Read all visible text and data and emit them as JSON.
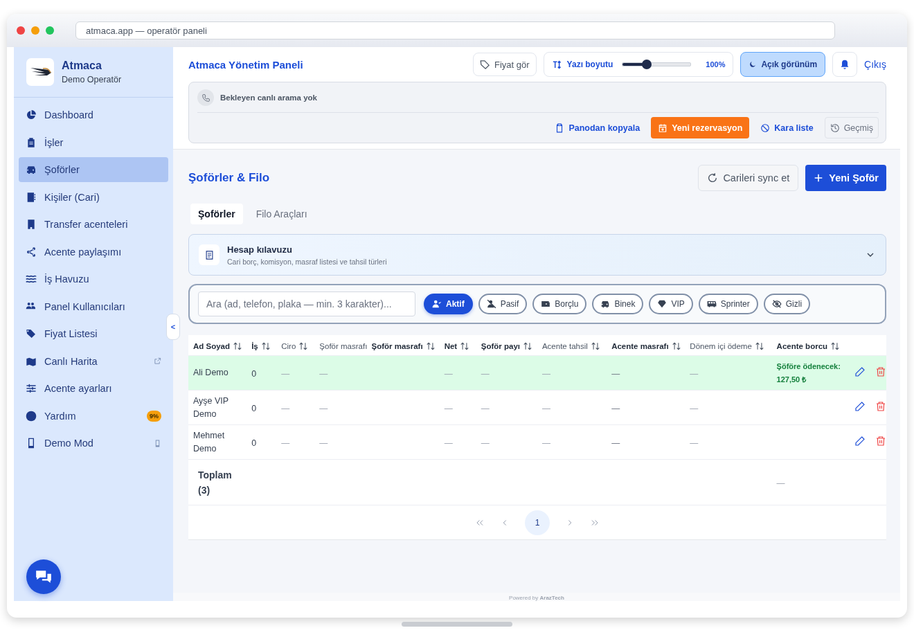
{
  "browser": {
    "address": "atmaca.app — operatör paneli"
  },
  "brand": {
    "name": "Atmaca",
    "subtitle": "Demo Operatör"
  },
  "sidebar": {
    "items": [
      {
        "label": "Dashboard",
        "selected": false,
        "kind": "plain"
      },
      {
        "label": "İşler",
        "selected": false,
        "kind": "plain"
      },
      {
        "label": "Şoförler",
        "selected": true,
        "kind": "plain"
      },
      {
        "label": "Kişiler (Cari)",
        "selected": false,
        "kind": "plain"
      },
      {
        "label": "Transfer acenteleri",
        "selected": false,
        "kind": "plain"
      },
      {
        "label": "Acente paylaşımı",
        "selected": false,
        "kind": "plain"
      },
      {
        "label": "İş Havuzu",
        "selected": false,
        "kind": "plain"
      },
      {
        "label": "Panel Kullanıcıları",
        "selected": false,
        "kind": "plain"
      },
      {
        "label": "Fiyat Listesi",
        "selected": false,
        "kind": "plain"
      },
      {
        "label": "Canlı Harita",
        "selected": false,
        "kind": "external"
      },
      {
        "label": "Acente ayarları",
        "selected": false,
        "kind": "plain"
      },
      {
        "label": "Yardım",
        "selected": false,
        "kind": "badge",
        "badge": "9%"
      },
      {
        "label": "Demo Mod",
        "selected": false,
        "kind": "device"
      }
    ],
    "collapse_button": "<"
  },
  "header": {
    "title": "Atmaca Yönetim Paneli",
    "price_button": "Fiyat gör",
    "font_size": {
      "label": "Yazı boyutu",
      "level": 0.35,
      "reading": "100%"
    },
    "theme_button": "Açık görünüm",
    "logout": "Çıkış"
  },
  "call_panel": {
    "status": "Bekleyen canlı arama yok",
    "actions": [
      {
        "label": "Panodan kopyala",
        "kind": "link"
      },
      {
        "label": "Yeni rezervasyon",
        "kind": "primary"
      },
      {
        "label": "Kara liste",
        "kind": "link"
      },
      {
        "label": "Geçmiş",
        "kind": "outline"
      }
    ]
  },
  "page": {
    "title": "Şoförler & Filo",
    "sync_button": "Carileri sync et",
    "new_button": "Yeni Şoför"
  },
  "tabs": [
    {
      "label": "Şoförler",
      "selected": true
    },
    {
      "label": "Filo Araçları",
      "selected": false
    }
  ],
  "guide": {
    "title": "Hesap kılavuzu",
    "subtitle": "Cari borç, komisyon, masraf listesi ve tahsil türleri",
    "expanded": false
  },
  "filters": {
    "search": {
      "placeholder": "Ara (ad, telefon, plaka — min. 3 karakter)..."
    },
    "chips": [
      {
        "label": "Aktif",
        "selected": true
      },
      {
        "label": "Pasif",
        "selected": false
      },
      {
        "label": "Borçlu",
        "selected": false
      },
      {
        "label": "Binek",
        "selected": false
      },
      {
        "label": "VIP",
        "selected": false
      },
      {
        "label": "Sprinter",
        "selected": false
      },
      {
        "label": "Gizli",
        "selected": false
      }
    ]
  },
  "table": {
    "columns": [
      {
        "label": "Ad Soyad",
        "bold": true,
        "sortable": true
      },
      {
        "label": "İş",
        "bold": true,
        "sortable": true
      },
      {
        "label": "Ciro",
        "bold": false,
        "sortable": true
      },
      {
        "label": "Şoför masrafı",
        "bold": false,
        "sortable": false
      },
      {
        "label": "Şoför masrafı",
        "bold": true,
        "sortable": true
      },
      {
        "label": "Net",
        "bold": true,
        "sortable": true
      },
      {
        "label": "Şoför payı",
        "bold": true,
        "sortable": true
      },
      {
        "label": "Acente tahsil",
        "bold": false,
        "sortable": true
      },
      {
        "label": "Acente masrafı",
        "bold": true,
        "sortable": true
      },
      {
        "label": "Dönem içi ödeme",
        "bold": false,
        "sortable": true
      },
      {
        "label": "Acente borcu",
        "bold": true,
        "sortable": true
      }
    ],
    "rows": [
      {
        "highlighted": true,
        "cells": [
          "Ali Demo",
          "0",
          "—",
          "—",
          null,
          "—",
          "—",
          "—",
          "—",
          "—",
          "Şöföre ödenecek: 127,50 ₺"
        ]
      },
      {
        "highlighted": false,
        "cells": [
          "Ayşe VIP Demo",
          "0",
          "—",
          "—",
          null,
          "—",
          "—",
          "—",
          "—",
          "—",
          null
        ]
      },
      {
        "highlighted": false,
        "cells": [
          "Mehmet Demo",
          "0",
          "—",
          "—",
          null,
          "—",
          "—",
          "—",
          "—",
          "—",
          null
        ]
      }
    ],
    "total": {
      "cells": [
        "Toplam (3)",
        null,
        null,
        null,
        null,
        null,
        null,
        null,
        null,
        null,
        "—"
      ]
    }
  },
  "pagination": {
    "pages": [
      {
        "label": "1",
        "selected": true
      }
    ]
  },
  "footer": "Powered by **ArazTech**"
}
